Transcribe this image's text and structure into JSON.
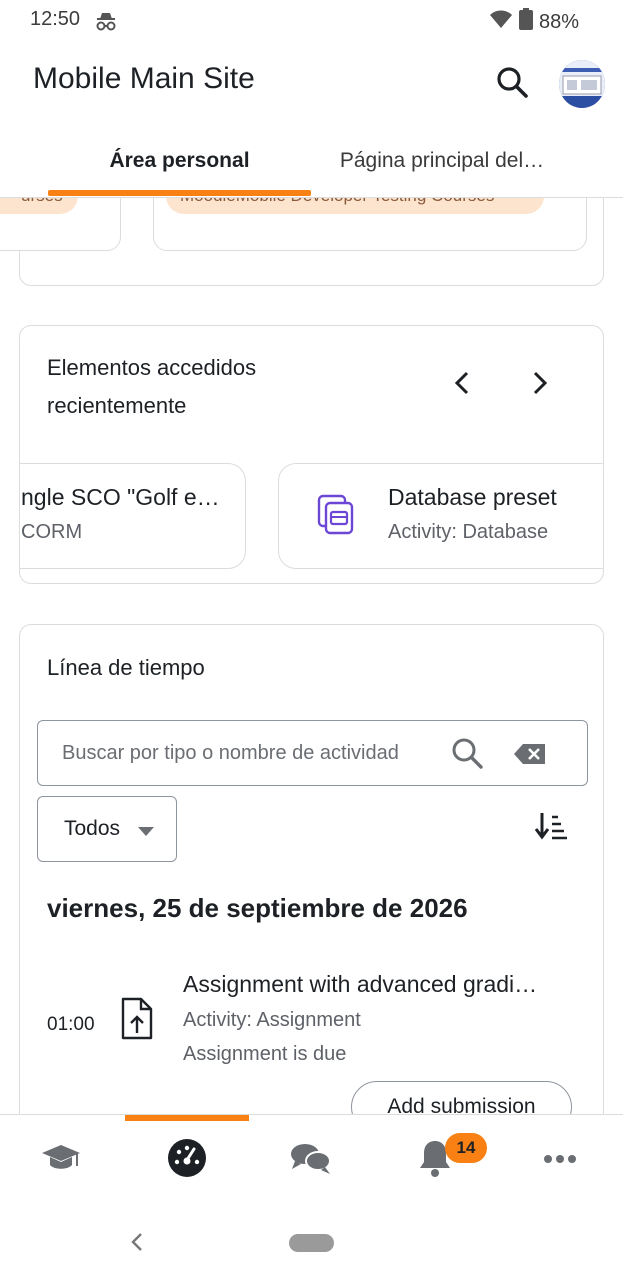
{
  "status_bar": {
    "time": "12:50",
    "battery": "88%"
  },
  "header": {
    "title": "Mobile Main Site"
  },
  "tabs": [
    {
      "label": "Área personal",
      "active": true
    },
    {
      "label": "Página principal del…",
      "active": false
    }
  ],
  "courses_partial": {
    "pill_left": "urses",
    "pill_right": "MoodleMobile Developer Testing Courses"
  },
  "recent": {
    "title_line1": "Elementos accedidos",
    "title_line2": "recientemente",
    "items": [
      {
        "title": "ngle SCO \"Golf e…",
        "subtitle": "CORM"
      },
      {
        "title": "Database preset",
        "subtitle": "Activity: Database"
      }
    ]
  },
  "timeline": {
    "title": "Línea de tiempo",
    "search_placeholder": "Buscar por tipo o nombre de actividad",
    "filter_value": "Todos",
    "date_heading": "viernes, 25 de septiembre de 2026",
    "events": [
      {
        "time": "01:00",
        "title": "Assignment with advanced gradi…",
        "subtitle": "Activity: Assignment",
        "status": "Assignment is due",
        "action": "Add submission"
      }
    ]
  },
  "bottom_nav": {
    "notifications_count": "14"
  },
  "colors": {
    "accent": "#f98012",
    "pill_bg": "#fde4cf"
  }
}
